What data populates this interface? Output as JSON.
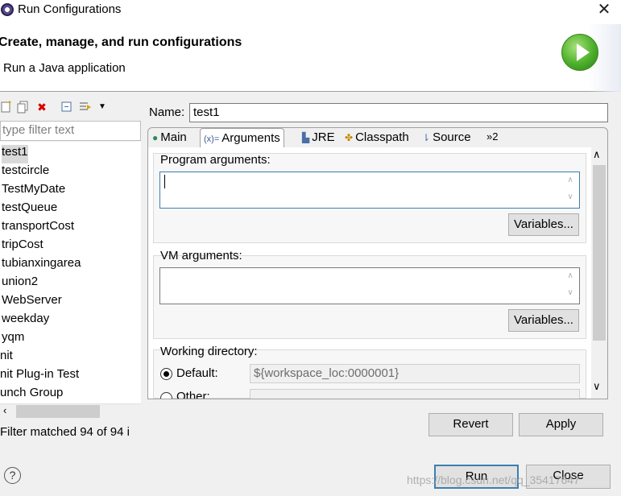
{
  "window": {
    "title": "Run Configurations",
    "close_glyph": "✕"
  },
  "banner": {
    "title": "Create, manage, and run configurations",
    "subtitle": "Run a Java application"
  },
  "toolbar": {
    "icons": [
      "new-configuration-icon",
      "duplicate-icon",
      "delete-icon",
      "collapse-all-icon",
      "filter-icon",
      "dropdown-arrow-icon"
    ],
    "delete_glyph": "✖",
    "dropdown_glyph": "▼"
  },
  "filter": {
    "placeholder": "type filter text",
    "status": "Filter matched 94 of 94 i"
  },
  "configs": [
    {
      "label": "test1",
      "selected": true
    },
    {
      "label": "testcircle"
    },
    {
      "label": "TestMyDate"
    },
    {
      "label": "testQueue"
    },
    {
      "label": "transportCost"
    },
    {
      "label": "tripCost"
    },
    {
      "label": "tubianxingarea"
    },
    {
      "label": "union2"
    },
    {
      "label": "WebServer"
    },
    {
      "label": "weekday"
    },
    {
      "label": "yqm"
    },
    {
      "label": "nit"
    },
    {
      "label": "nit Plug-in Test"
    },
    {
      "label": "unch Group"
    }
  ],
  "name": {
    "label": "Name:",
    "value": "test1"
  },
  "tabs": [
    {
      "label": "Main",
      "icon": "main-tab-icon",
      "glyph": "●"
    },
    {
      "label": "Arguments",
      "icon": "arguments-tab-icon",
      "glyph": "(x)=",
      "active": true
    },
    {
      "label": "JRE",
      "icon": "jre-tab-icon",
      "glyph": "▙"
    },
    {
      "label": "Classpath",
      "icon": "classpath-tab-icon",
      "glyph": "✤"
    },
    {
      "label": "Source",
      "icon": "source-tab-icon",
      "glyph": "⇂"
    },
    {
      "label": "»2",
      "icon": "more-tabs-icon"
    }
  ],
  "arguments": {
    "program_label": "Program arguments:",
    "program_value": "",
    "program_variables": "Variables...",
    "vm_label": "VM arguments:",
    "vm_value": "",
    "vm_variables": "Variables...",
    "working_dir_label": "Working directory:",
    "default_label": "Default:",
    "default_value": "${workspace_loc:0000001}",
    "other_label": "Other:",
    "default_selected": true
  },
  "buttons": {
    "revert": "Revert",
    "apply": "Apply",
    "run": "Run",
    "close": "Close"
  },
  "help": {
    "glyph": "?"
  },
  "watermark": "https://blog.csdn.net/qq_35417647",
  "colors": {
    "run_logo": "#4caf2a",
    "focus_border": "#3c7fb1",
    "delete_icon": "#d40000"
  }
}
